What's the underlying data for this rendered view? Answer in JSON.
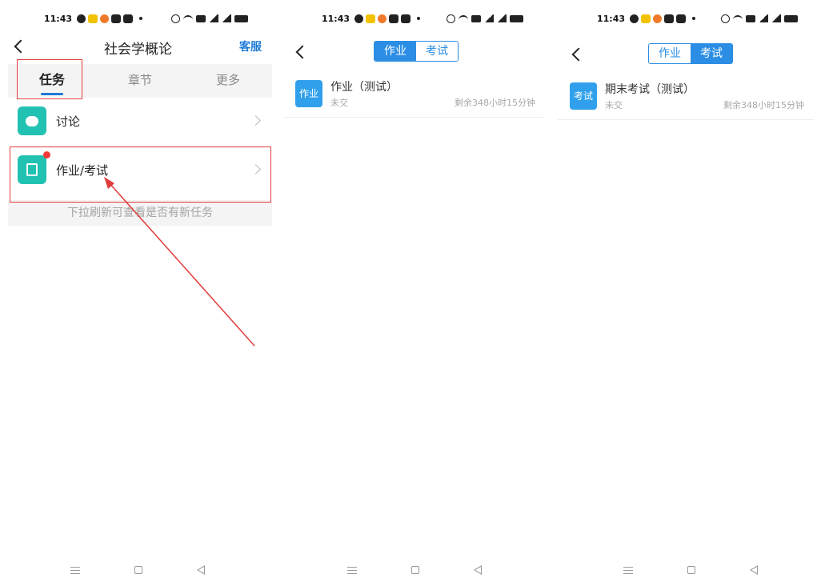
{
  "status": {
    "time": "11:43"
  },
  "screen1": {
    "title": "社会学概论",
    "service": "客服",
    "tabs": [
      "任务",
      "章节",
      "更多"
    ],
    "rows": [
      {
        "label": "讨论",
        "icon": "chat-bubble-icon"
      },
      {
        "label": "作业/考试",
        "icon": "edit-document-icon",
        "has_new": true
      }
    ],
    "hint": "下拉刷新可查看是否有新任务"
  },
  "screen2": {
    "segments": [
      "作业",
      "考试"
    ],
    "active_segment": "作业",
    "item": {
      "badge": "作业",
      "name": "作业（测试）",
      "state": "未交",
      "remain": "剩余348小时15分钟"
    }
  },
  "screen3": {
    "segments": [
      "作业",
      "考试"
    ],
    "active_segment": "考试",
    "item": {
      "badge": "考试",
      "name": "期末考试（测试）",
      "state": "未交",
      "remain": "剩余348小时15分钟"
    }
  },
  "colors": {
    "accent": "#2b8ee4",
    "teal": "#22c2b2",
    "annotation": "#e23b3b"
  }
}
